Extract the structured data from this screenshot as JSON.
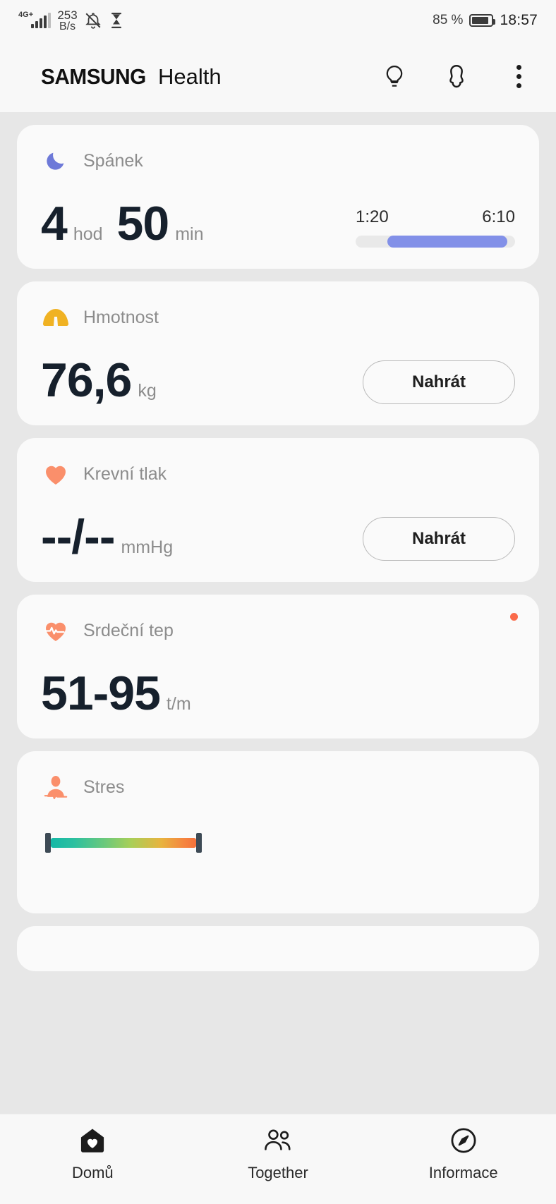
{
  "status_bar": {
    "network_type": "4G",
    "network_sup": "+",
    "data_rate_value": "253",
    "data_rate_unit": "B/s",
    "icons": [
      "bell-muted-icon",
      "hourglass-icon"
    ],
    "battery_percent": "85 %",
    "battery_level": 85,
    "clock": "18:57"
  },
  "header": {
    "brand_samsung": "SAMSUNG",
    "brand_app": "Health",
    "actions": [
      {
        "name": "tips-icon",
        "label": "Tipy"
      },
      {
        "name": "profile-icon",
        "label": "Profil"
      },
      {
        "name": "more-options-icon",
        "label": "Více možností"
      }
    ]
  },
  "cards": {
    "sleep": {
      "title": "Spánek",
      "icon": "moon-icon",
      "icon_color": "#6d79d8",
      "hours_value": "4",
      "hours_unit": "hod",
      "minutes_value": "50",
      "minutes_unit": "min",
      "time_start": "1:20",
      "time_end": "6:10",
      "bar_fill_start_pct": 20,
      "bar_fill_end_pct": 95,
      "bar_color": "#8290e8"
    },
    "weight": {
      "title": "Hmotnost",
      "icon": "scale-icon",
      "icon_color": "#f0b223",
      "value": "76,6",
      "unit": "kg",
      "button_label": "Nahrát"
    },
    "blood_pressure": {
      "title": "Krevní tlak",
      "icon": "heart-icon",
      "icon_color": "#fa8f6b",
      "value": "--/--",
      "unit": "mmHg",
      "button_label": "Nahrát"
    },
    "heart_rate": {
      "title": "Srdeční tep",
      "icon": "heart-pulse-icon",
      "icon_color": "#fa8f6b",
      "value": "51-95",
      "unit": "t/m",
      "has_notification_dot": true,
      "notification_dot_color": "#fa6a4a"
    },
    "stress": {
      "title": "Stres",
      "icon": "stress-person-icon",
      "icon_color": "#fa8f6b",
      "gauge_colors": [
        "#15b8a6",
        "#6ec97a",
        "#e8b33f",
        "#f4713b"
      ]
    }
  },
  "bottom_nav": [
    {
      "label": "Domů",
      "icon": "home-heart-icon",
      "selected": true
    },
    {
      "label": "Together",
      "icon": "people-icon",
      "selected": false
    },
    {
      "label": "Informace",
      "icon": "compass-icon",
      "selected": false
    }
  ]
}
